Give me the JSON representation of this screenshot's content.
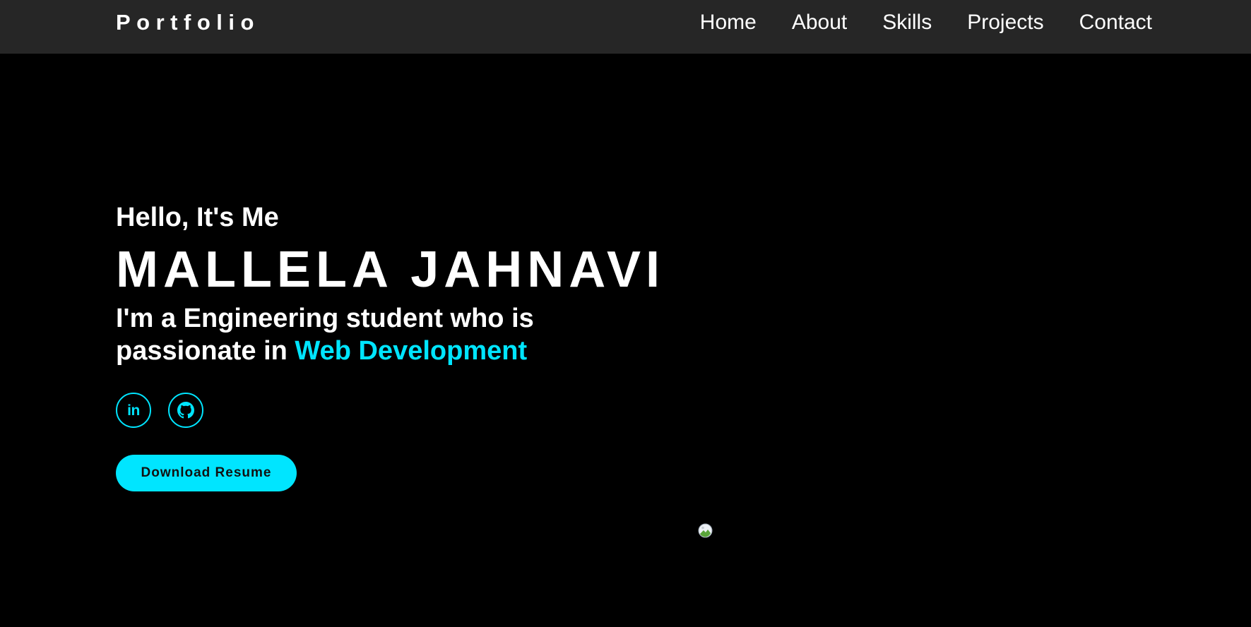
{
  "header": {
    "logo": "Portfolio",
    "nav": [
      {
        "label": "Home"
      },
      {
        "label": "About"
      },
      {
        "label": "Skills"
      },
      {
        "label": "Projects"
      },
      {
        "label": "Contact"
      }
    ]
  },
  "hero": {
    "greeting": "Hello, It's Me",
    "name": "MALLELA JAHNAVI",
    "tagline_prefix": "I'm a Engineering student who is passionate in ",
    "tagline_highlight": "Web Development",
    "socials": [
      {
        "icon": "linkedin-icon",
        "glyph": "in"
      },
      {
        "icon": "github-icon"
      }
    ],
    "resume_button": "Download Resume",
    "image": {
      "icon": "broken-image-icon"
    }
  },
  "colors": {
    "background": "#000000",
    "navbar": "#262626",
    "accent": "#00e5ff",
    "text": "#ffffff"
  }
}
